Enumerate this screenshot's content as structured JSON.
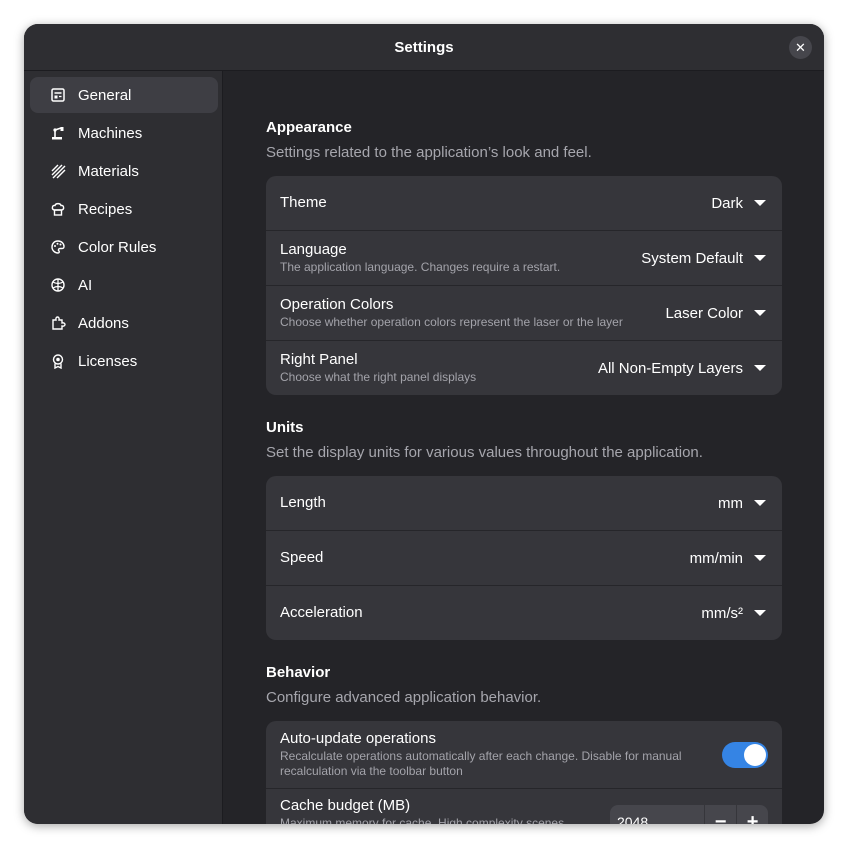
{
  "window": {
    "title": "Settings",
    "close_icon": "close-icon"
  },
  "sidebar": {
    "items": [
      {
        "label": "General",
        "icon": "general-icon",
        "active": true
      },
      {
        "label": "Machines",
        "icon": "machine-icon",
        "active": false
      },
      {
        "label": "Materials",
        "icon": "materials-icon",
        "active": false
      },
      {
        "label": "Recipes",
        "icon": "recipe-icon",
        "active": false
      },
      {
        "label": "Color Rules",
        "icon": "palette-icon",
        "active": false
      },
      {
        "label": "AI",
        "icon": "ai-icon",
        "active": false
      },
      {
        "label": "Addons",
        "icon": "puzzle-icon",
        "active": false
      },
      {
        "label": "Licenses",
        "icon": "license-icon",
        "active": false
      }
    ]
  },
  "appearance": {
    "title": "Appearance",
    "description": "Settings related to the application’s look and feel.",
    "rows": [
      {
        "label": "Theme",
        "subtitle": "",
        "value": "Dark"
      },
      {
        "label": "Language",
        "subtitle": "The application language. Changes require a restart.",
        "value": "System Default"
      },
      {
        "label": "Operation Colors",
        "subtitle": "Choose whether operation colors represent the laser or the layer",
        "value": "Laser Color"
      },
      {
        "label": "Right Panel",
        "subtitle": "Choose what the right panel displays",
        "value": "All Non-Empty Layers"
      }
    ]
  },
  "units": {
    "title": "Units",
    "description": "Set the display units for various values throughout the application.",
    "rows": [
      {
        "label": "Length",
        "value": "mm"
      },
      {
        "label": "Speed",
        "value": "mm/min"
      },
      {
        "label": "Acceleration",
        "value": "mm/s²"
      }
    ]
  },
  "behavior": {
    "title": "Behavior",
    "description": "Configure advanced application behavior.",
    "auto_update": {
      "label": "Auto-update operations",
      "subtitle": "Recalculate operations automatically after each change. Disable for manual recalculation via the toolbar button",
      "enabled": true
    },
    "cache": {
      "label": "Cache budget (MB)",
      "subtitle": "Maximum memory for cache. High complexity scenes require more",
      "value": "2048",
      "minus": "−",
      "plus": "+"
    }
  },
  "colors": {
    "accent": "#3584e4",
    "window_bg": "#242428",
    "sidebar_bg": "#2e2e32",
    "card_bg": "#36363b"
  }
}
